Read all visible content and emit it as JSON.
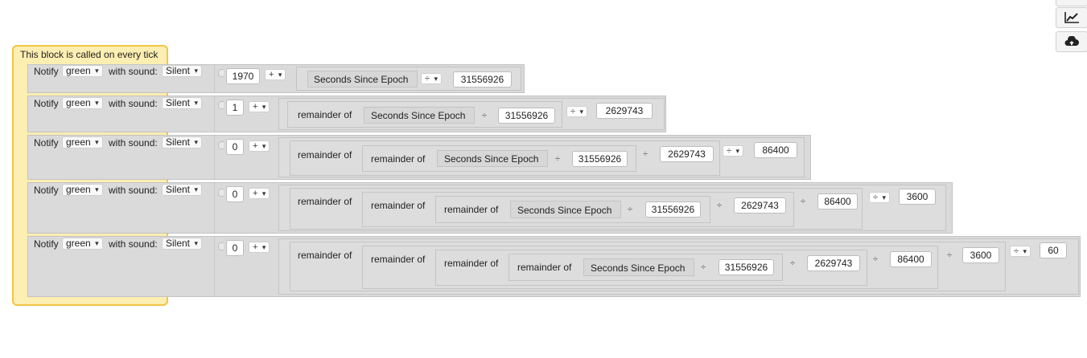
{
  "toolbar": {
    "icons": [
      "line-chart-icon",
      "cloud-upload-icon"
    ]
  },
  "event": {
    "label": "This block is called on every tick"
  },
  "common": {
    "notify_label": "Notify",
    "color_value": "green",
    "with_sound_label": "with sound:",
    "sound_value": "Silent",
    "remainder_label": "remainder of",
    "seconds_since_epoch": "Seconds Since Epoch",
    "plus_op": "+",
    "div_op": "÷",
    "div_symbol": "÷"
  },
  "rows": [
    {
      "start": "1970",
      "values": [
        "31556926"
      ]
    },
    {
      "start": "1",
      "values": [
        "31556926",
        "2629743"
      ]
    },
    {
      "start": "0",
      "values": [
        "31556926",
        "2629743",
        "86400"
      ]
    },
    {
      "start": "0",
      "values": [
        "31556926",
        "2629743",
        "86400",
        "3600"
      ]
    },
    {
      "start": "0",
      "values": [
        "31556926",
        "2629743",
        "86400",
        "3600",
        "60"
      ]
    }
  ]
}
